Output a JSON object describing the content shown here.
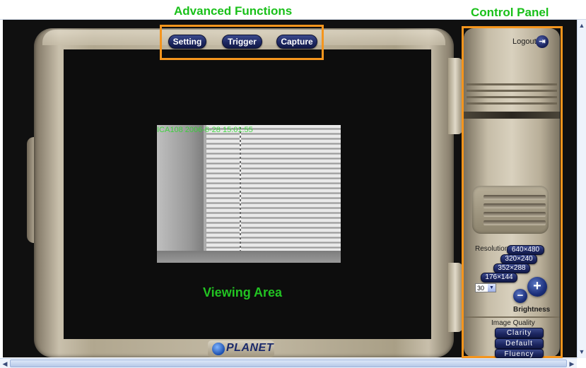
{
  "annotations": {
    "advanced_functions": "Advanced Functions",
    "control_panel": "Control Panel",
    "viewing_area": "Viewing Area"
  },
  "toolbar": {
    "setting": "Setting",
    "trigger": "Trigger",
    "capture": "Capture"
  },
  "camera": {
    "overlay_text": "ICA108  2006-6-28  15:01:55"
  },
  "logo": {
    "text": "PLANET"
  },
  "control_panel": {
    "logout": "Logout",
    "logout_icon": "door-exit-icon",
    "resolution_label": "Resolution",
    "resolutions": [
      "640×480",
      "320×240",
      "352×288",
      "176×144"
    ],
    "fps_value": "30",
    "brightness_label": "Brightness",
    "brightness_minus": "−",
    "brightness_plus": "+",
    "image_quality_label": "Image Quality",
    "quality_options": [
      "Clarity",
      "Default",
      "Fluency"
    ]
  },
  "colors": {
    "annotation_green": "#19c019",
    "annotation_orange": "#f5951d",
    "button_navy": "#1c2660"
  }
}
